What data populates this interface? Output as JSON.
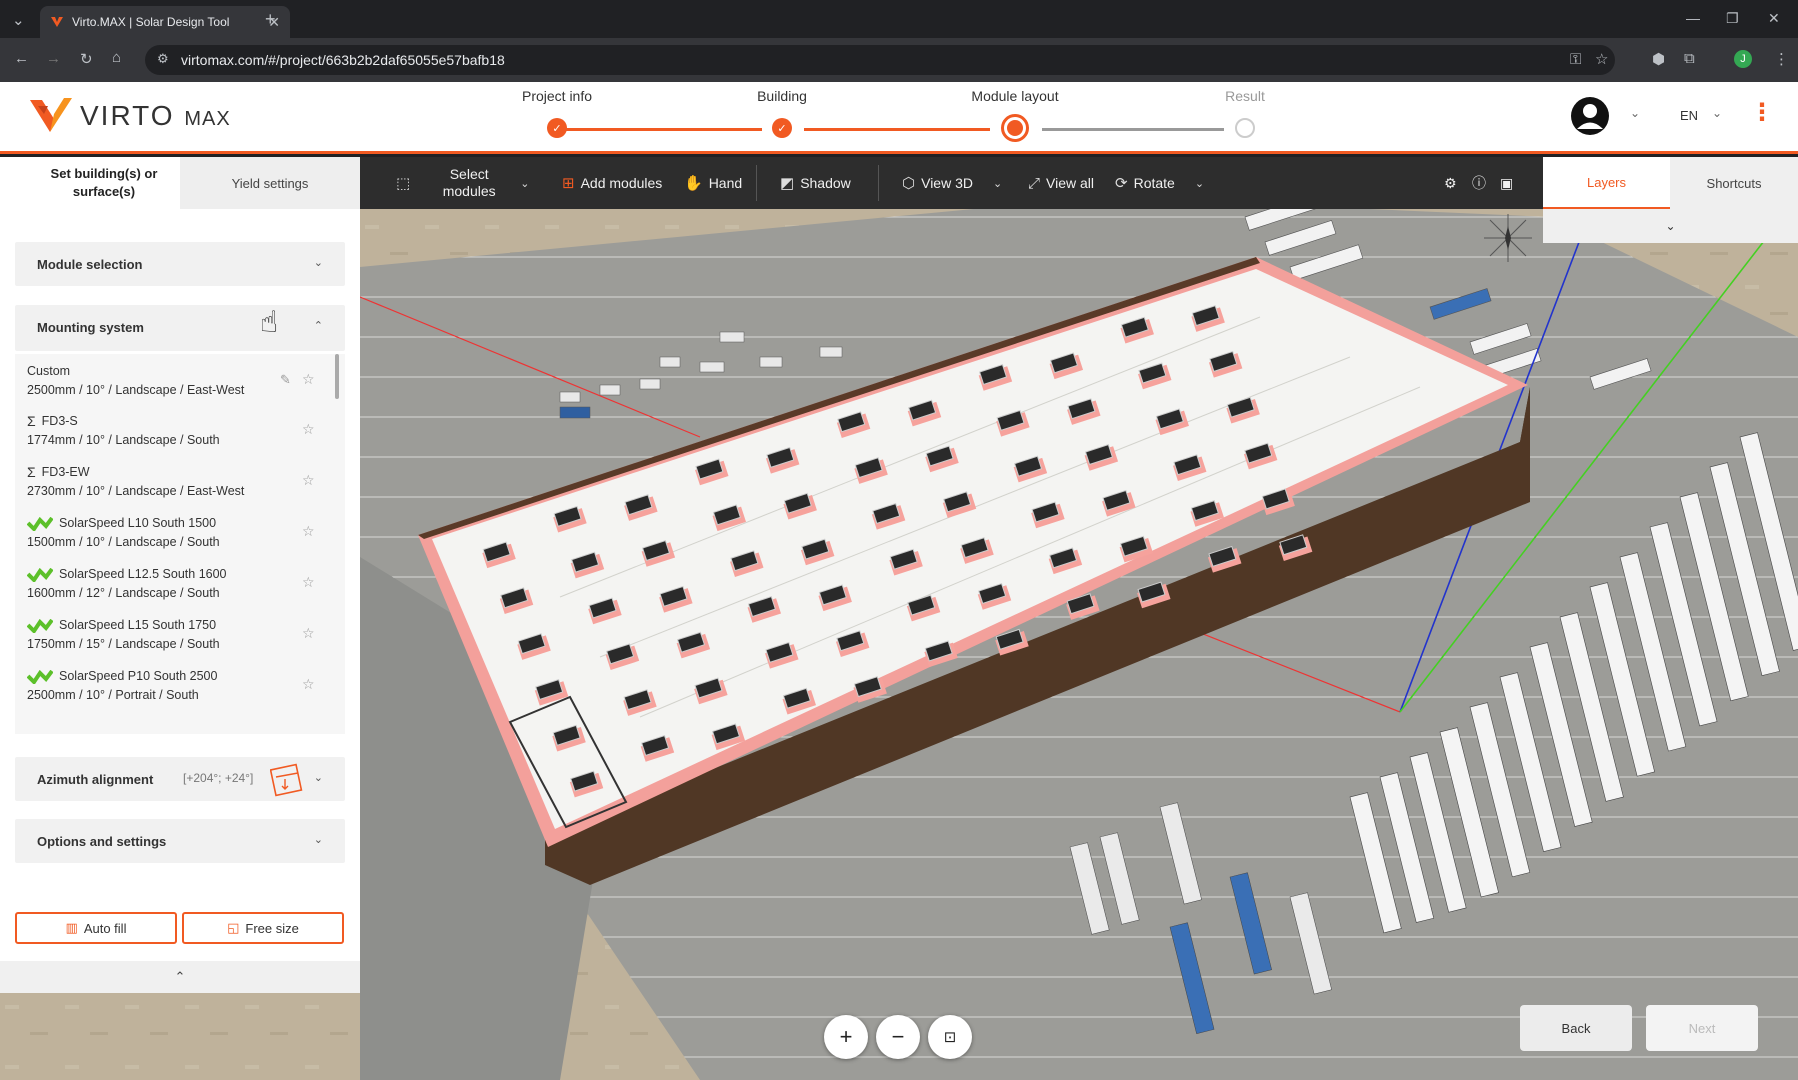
{
  "browser": {
    "tab_title": "Virto.MAX | Solar Design Tool",
    "url": "virtomax.com/#/project/663b2b2daf65055e57bafb18"
  },
  "brand": {
    "name": "VIRTO",
    "suffix": "MAX"
  },
  "stepper": {
    "steps": [
      "Project info",
      "Building",
      "Module layout",
      "Result"
    ]
  },
  "header": {
    "language": "EN"
  },
  "left_panel": {
    "tabs": {
      "active": "Set building(s) or surface(s)",
      "other": "Yield settings"
    },
    "sections": {
      "module_selection": "Module selection",
      "mounting_system": "Mounting system",
      "azimuth_alignment": "Azimuth alignment",
      "azimuth_value": "[+204°; +24°]",
      "options_settings": "Options and settings"
    },
    "mounting_items": [
      {
        "name": "Custom",
        "detail": "2500mm / 10° / Landscape / East-West"
      },
      {
        "name": "FD3-S",
        "detail": "1774mm / 10° / Landscape / South"
      },
      {
        "name": "FD3-EW",
        "detail": "2730mm / 10° / Landscape / East-West"
      },
      {
        "name": "SolarSpeed L10 South 1500",
        "detail": "1500mm / 10° / Landscape / South"
      },
      {
        "name": "SolarSpeed L12.5 South 1600",
        "detail": "1600mm / 12° / Landscape / South"
      },
      {
        "name": "SolarSpeed L15 South 1750",
        "detail": "1750mm / 15° / Landscape / South"
      },
      {
        "name": "SolarSpeed P10 South 2500",
        "detail": "2500mm / 10° / Portrait / South"
      }
    ],
    "buttons": {
      "auto_fill": "Auto fill",
      "free_size": "Free size"
    }
  },
  "toolbar": {
    "select_modules": "Select modules",
    "add_modules": "Add modules",
    "hand": "Hand",
    "shadow": "Shadow",
    "view_3d": "View 3D",
    "view_all": "View all",
    "rotate": "Rotate"
  },
  "right_panel": {
    "tab_layers": "Layers",
    "tab_shortcuts": "Shortcuts"
  },
  "nav": {
    "back": "Back",
    "next": "Next"
  },
  "colors": {
    "accent": "#f15a22",
    "roof": "#f2f2f0",
    "roof_outline": "#f3a09b",
    "building_wall": "#4a3322"
  }
}
